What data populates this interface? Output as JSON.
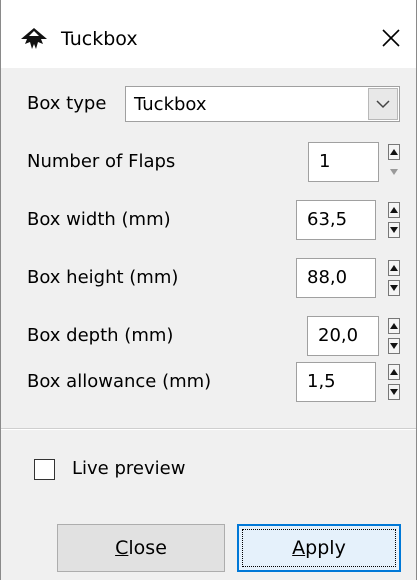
{
  "window": {
    "title": "Tuckbox",
    "icons": {
      "app": "inkscape-icon",
      "close": "close-icon"
    }
  },
  "form": {
    "box_type": {
      "label": "Box type",
      "value": "Tuckbox"
    },
    "number_of_flaps": {
      "label": "Number of Flaps",
      "value": "1"
    },
    "box_width": {
      "label": "Box width (mm)",
      "value": "63,5"
    },
    "box_height": {
      "label": "Box height (mm)",
      "value": "88,0"
    },
    "box_depth": {
      "label": "Box depth (mm)",
      "value": "20,0"
    },
    "box_allowance": {
      "label": "Box allowance (mm)",
      "value": "1,5"
    }
  },
  "live_preview": {
    "label": "Live preview",
    "checked": false
  },
  "buttons": {
    "close": {
      "mnemonic": "C",
      "rest": "lose"
    },
    "apply": {
      "mnemonic": "A",
      "rest": "pply"
    }
  },
  "colors": {
    "accent": "#0078d7",
    "background": "#f0f0f0"
  }
}
